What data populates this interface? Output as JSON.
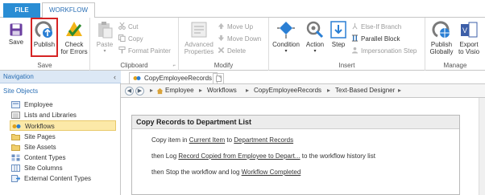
{
  "tabs": {
    "file": "FILE",
    "workflow": "WORKFLOW"
  },
  "ribbon": {
    "save": {
      "save": "Save",
      "publish": "Publish",
      "check_errors_1": "Check",
      "check_errors_2": "for Errors",
      "label": "Save"
    },
    "clipboard": {
      "paste": "Paste",
      "cut": "Cut",
      "copy": "Copy",
      "format_painter": "Format Painter",
      "label": "Clipboard"
    },
    "modify": {
      "advanced_1": "Advanced",
      "advanced_2": "Properties",
      "move_up": "Move Up",
      "move_down": "Move Down",
      "delete": "Delete",
      "label": "Modify"
    },
    "insert": {
      "condition": "Condition",
      "action": "Action",
      "step": "Step",
      "else_if": "Else-If Branch",
      "parallel": "Parallel Block",
      "impersonation": "Impersonation Step",
      "label": "Insert"
    },
    "manage": {
      "publish_globally_1": "Publish",
      "publish_globally_2": "Globally",
      "export_1": "Export",
      "export_2": "to Visio",
      "label": "Manage"
    },
    "dropdown_arrow": "▾",
    "launcher_glyph": "⌐"
  },
  "nav": {
    "header": "Navigation",
    "collapse_glyph": "‹",
    "section": "Site Objects",
    "items": [
      {
        "label": "Employee"
      },
      {
        "label": "Lists and Libraries"
      },
      {
        "label": "Workflows"
      },
      {
        "label": "Site Pages"
      },
      {
        "label": "Site Assets"
      },
      {
        "label": "Content Types"
      },
      {
        "label": "Site Columns"
      },
      {
        "label": "External Content Types"
      }
    ]
  },
  "doc_tab": "CopyEmployeeRecords",
  "breadcrumb": {
    "back": "◀",
    "forward": "▶",
    "up": "▴",
    "items": [
      "Employee",
      "Workflows",
      "CopyEmployeeRecords",
      "Text-Based Designer"
    ],
    "sep": "▸",
    "expander": "▸"
  },
  "stage": {
    "title": "Copy Records to Department List",
    "lines": [
      {
        "pre": "Copy item in ",
        "link1": "Current Item",
        "mid": " to ",
        "link2": "Department Records",
        "post": ""
      },
      {
        "pre": "then Log ",
        "link1": "Record Copied from Employee to Depart...",
        "mid": " to the workflow history list",
        "link2": "",
        "post": ""
      },
      {
        "pre": "then Stop the workflow and log ",
        "link1": "Workflow Completed",
        "mid": "",
        "link2": "",
        "post": ""
      }
    ]
  }
}
